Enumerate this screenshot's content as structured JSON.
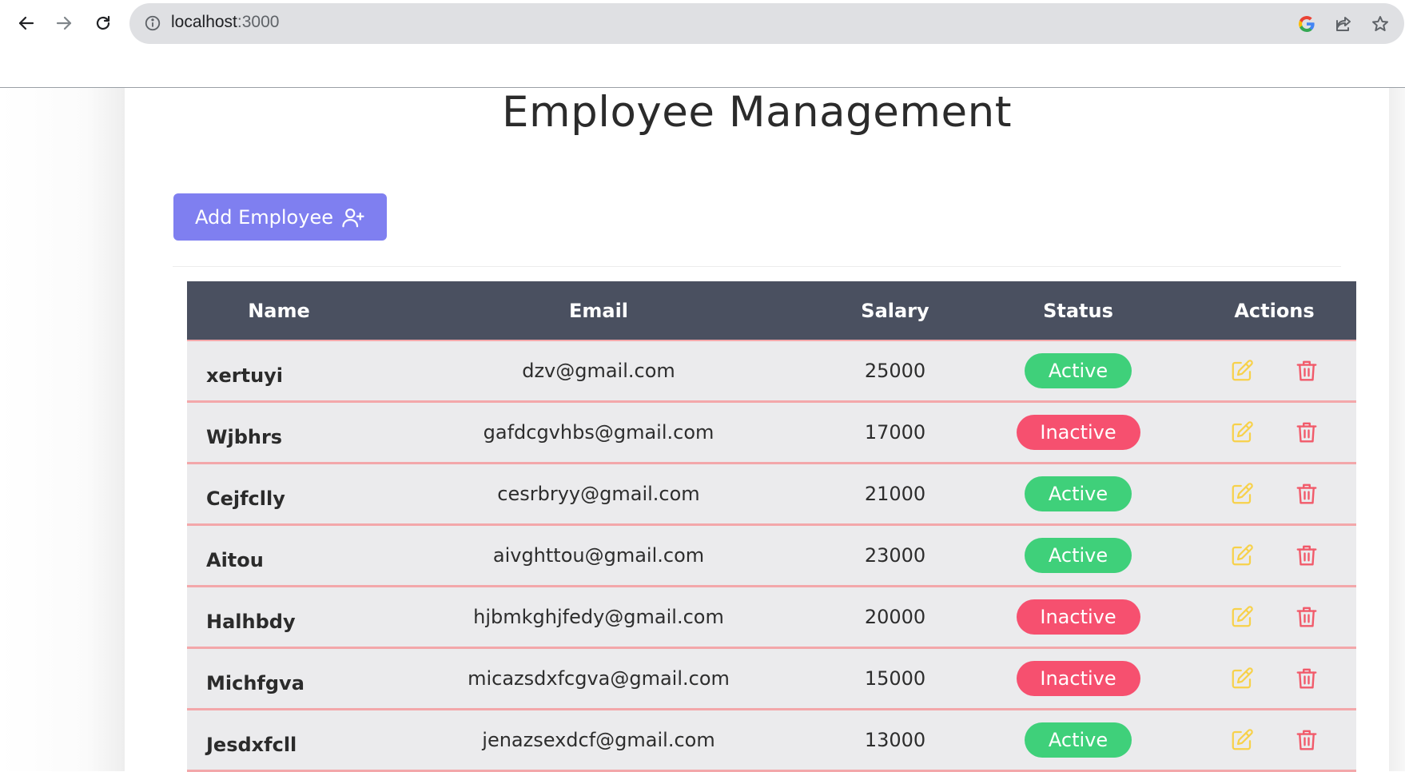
{
  "browser": {
    "url": "localhost:3000",
    "url_host": "localhost",
    "url_port": ":3000"
  },
  "page": {
    "title": "Employee Management",
    "add_button_label": "Add Employee"
  },
  "table": {
    "headers": [
      "Name",
      "Email",
      "Salary",
      "Status",
      "Actions"
    ],
    "rows": [
      {
        "name": "xertuyi",
        "email": "dzv@gmail.com",
        "salary": "25000",
        "status": "Active"
      },
      {
        "name": "Wjbhrs",
        "email": "gafdcgvhbs@gmail.com",
        "salary": "17000",
        "status": "Inactive"
      },
      {
        "name": "Cejfclly",
        "email": "cesrbryy@gmail.com",
        "salary": "21000",
        "status": "Active"
      },
      {
        "name": "Aitou",
        "email": "aivghttou@gmail.com",
        "salary": "23000",
        "status": "Active"
      },
      {
        "name": "Halhbdy",
        "email": "hjbmkghjfedy@gmail.com",
        "salary": "20000",
        "status": "Inactive"
      },
      {
        "name": "Michfgva",
        "email": "micazsdxfcgva@gmail.com",
        "salary": "15000",
        "status": "Inactive"
      },
      {
        "name": "Jesdxfcll",
        "email": "jenazsexdcf@gmail.com",
        "salary": "13000",
        "status": "Active"
      }
    ]
  },
  "colors": {
    "add_button": "#7f7ff0",
    "table_header": "#4a5060",
    "row_background": "#ebebed",
    "row_border": "#f3a7aa",
    "active": "#3fd07a",
    "inactive": "#f6506f",
    "edit_icon": "#f7d14a",
    "delete_icon": "#f15a6a"
  },
  "icons": {
    "back": "arrow-left-icon",
    "forward": "arrow-right-icon",
    "reload": "reload-icon",
    "info": "info-icon",
    "google": "google-icon",
    "share": "share-icon",
    "bookmark": "star-icon",
    "add_user": "user-plus-icon",
    "edit": "edit-icon",
    "delete": "trash-icon"
  }
}
